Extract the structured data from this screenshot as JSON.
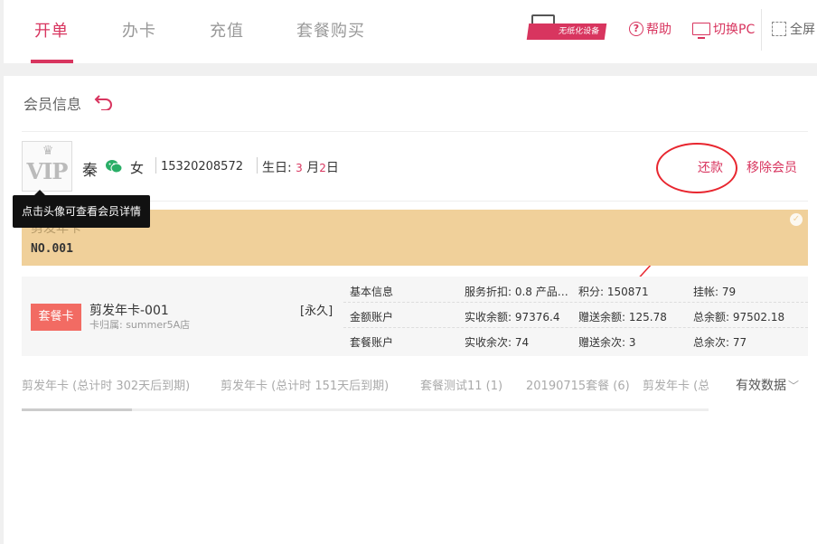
{
  "nav": {
    "tabs": [
      {
        "label": "开单",
        "active": true
      },
      {
        "label": "办卡",
        "active": false
      },
      {
        "label": "充值",
        "active": false
      },
      {
        "label": "套餐购买",
        "active": false
      }
    ],
    "device_badge": "无纸化设备",
    "help": "帮助",
    "switch_pc": "切换PC",
    "fullscreen": "全屏"
  },
  "member": {
    "section_title": "会员信息",
    "avatar_text": "VIP",
    "name": "秦",
    "gender": "女",
    "phone": "15320208572",
    "birthday_label": "生日:",
    "birthday_month": "3",
    "birthday_month_unit": "月",
    "birthday_day": "2",
    "birthday_day_unit": "日",
    "tooltip": "点击头像可查看会员详情",
    "repay": "还款",
    "remove": "移除会员"
  },
  "card": {
    "title": "剪发年卡",
    "number": "NO.001"
  },
  "package": {
    "badge": "套餐卡",
    "name": "剪发年卡-001",
    "store": "卡归属: summer5A店",
    "term": "[永久]",
    "rows": [
      {
        "label": "基本信息",
        "c1": "服务折扣: 0.8 产品…",
        "c2": "积分: 150871",
        "c3": "挂帐: 79"
      },
      {
        "label": "金额账户",
        "c1": "实收余额: 97376.4",
        "c2": "赠送余额: 125.78",
        "c3": "总余额: 97502.18"
      },
      {
        "label": "套餐账户",
        "c1": "实收余次: 74",
        "c2": "赠送余次: 3",
        "c3": "总余次: 77"
      }
    ]
  },
  "card_tabs": [
    "剪发年卡 (总计时 302天后到期)",
    "剪发年卡 (总计时 151天后到期)",
    "套餐测试11 (1)",
    "20190715套餐 (6)",
    "剪发年卡 (总"
  ],
  "filter": {
    "label": "有效数据"
  },
  "colors": {
    "accent": "#d8355f",
    "card_banner": "#f0d09a",
    "package_badge": "#f26b63",
    "annotation": "#e8262f"
  }
}
